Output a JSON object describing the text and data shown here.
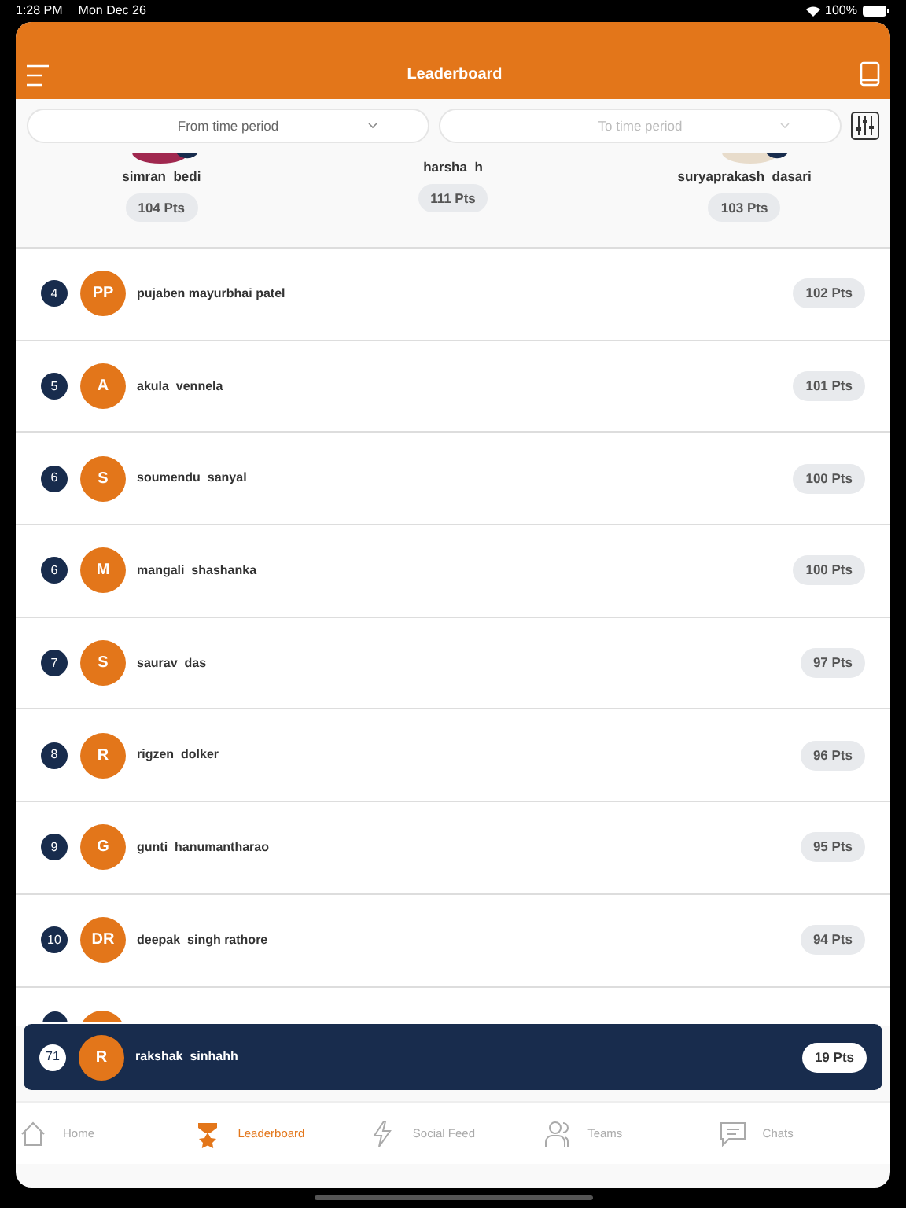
{
  "status_bar": {
    "time": "1:28 PM",
    "date": "Mon Dec 26",
    "battery": "100%"
  },
  "header": {
    "title": "Leaderboard"
  },
  "filters": [
    {
      "placeholder": "From time period",
      "disabled": false
    },
    {
      "placeholder": "To time period",
      "disabled": true
    }
  ],
  "podium": [
    {
      "name": "simran  bedi",
      "points": "104 Pts"
    },
    {
      "name": "harsha  h",
      "points": "111 Pts"
    },
    {
      "name": "suryaprakash  dasari",
      "points": "103 Pts"
    }
  ],
  "rows": [
    {
      "rank": "4",
      "initials": "PP",
      "name": "pujaben mayurbhai patel",
      "points": "102 Pts"
    },
    {
      "rank": "5",
      "initials": "A",
      "name": "akula  vennela",
      "points": "101 Pts"
    },
    {
      "rank": "6",
      "initials": "S",
      "name": "soumendu  sanyal",
      "points": "100 Pts"
    },
    {
      "rank": "6",
      "initials": "M",
      "name": "mangali  shashanka",
      "points": "100 Pts"
    },
    {
      "rank": "7",
      "initials": "S",
      "name": "saurav  das",
      "points": "97 Pts"
    },
    {
      "rank": "8",
      "initials": "R",
      "name": "rigzen  dolker",
      "points": "96 Pts"
    },
    {
      "rank": "9",
      "initials": "G",
      "name": "gunti  hanumantharao",
      "points": "95 Pts"
    },
    {
      "rank": "10",
      "initials": "DR",
      "name": "deepak  singh rathore",
      "points": "94 Pts"
    }
  ],
  "current_user": {
    "rank": "71",
    "initials": "R",
    "name": "rakshak  sinhahh",
    "points": "19 Pts"
  },
  "tab_bar": [
    {
      "kind": "home",
      "label": "Home",
      "selected": false
    },
    {
      "kind": "trophy",
      "label": "Leaderboard",
      "selected": true
    },
    {
      "kind": "bolt",
      "label": "Social Feed",
      "selected": false
    },
    {
      "kind": "people",
      "label": "Teams",
      "selected": false
    },
    {
      "kind": "chat",
      "label": "Chats",
      "selected": false
    }
  ]
}
